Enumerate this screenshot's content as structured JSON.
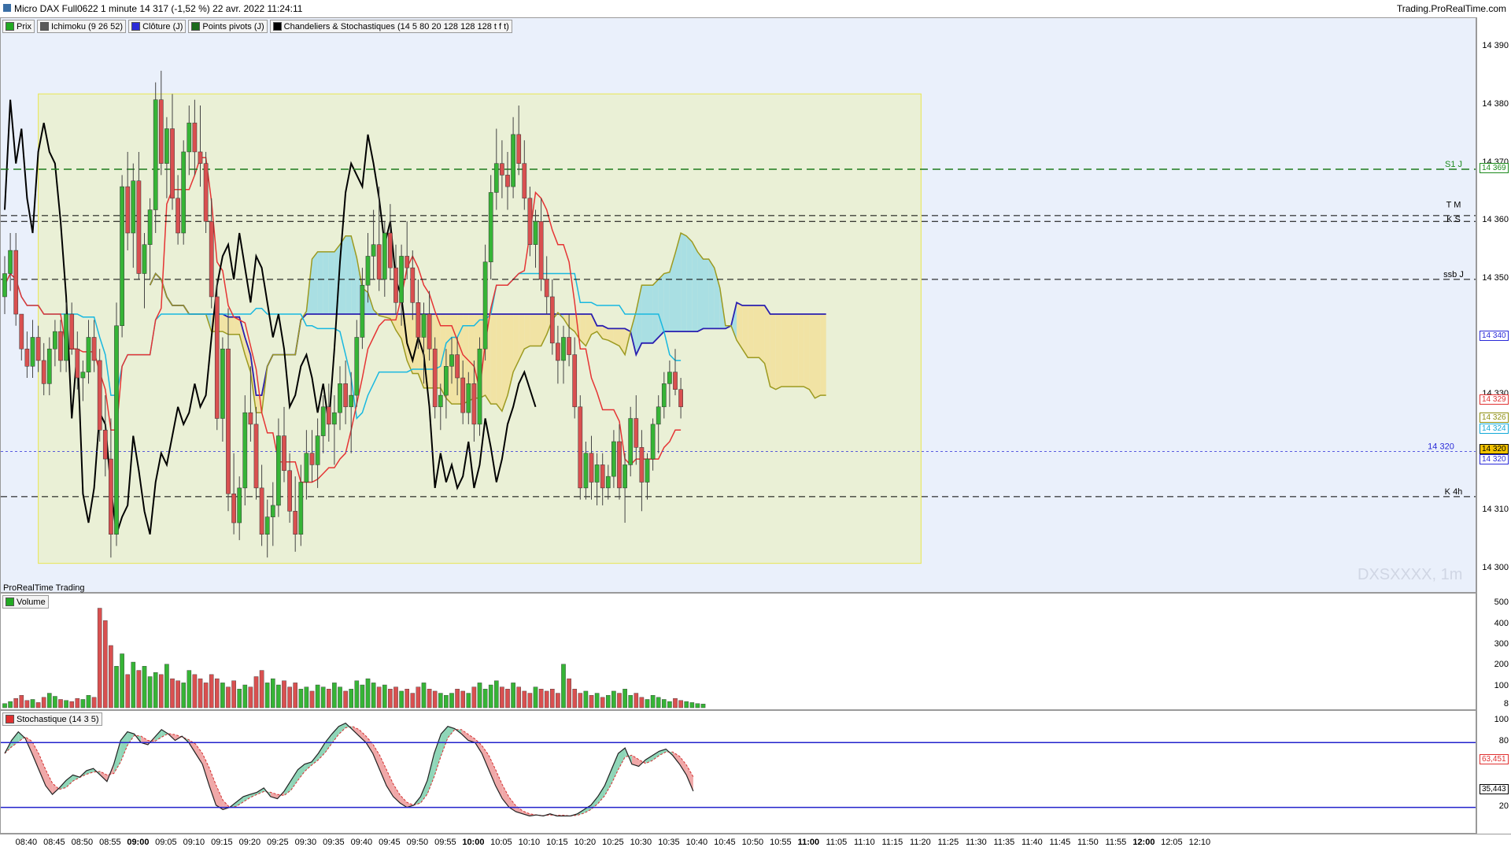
{
  "window": {
    "title": "Micro DAX Full0622 1 minute 14 317 (-1,52 %) 22 avr. 2022 11:24:11",
    "site": "Trading.ProRealTime.com"
  },
  "price_panel": {
    "legend": [
      {
        "label": "Prix",
        "color": "#22aa22"
      },
      {
        "label": "Ichimoku (9 26 52)",
        "color": "#5a5a5a"
      },
      {
        "label": "Clôture (J)",
        "color": "#2a2ad8"
      },
      {
        "label": "Points pivots (J)",
        "color": "#1c6b1c"
      },
      {
        "label": "Chandeliers & Stochastiques (14 5 80 20 128 128 128 t f t)",
        "color": "#000000"
      }
    ],
    "brand": "ProRealTime Trading",
    "watermark": "DXSXXXX, 1m",
    "y_ticks": [
      "14 390",
      "14 380",
      "14 370",
      "14 360",
      "14 350",
      "14 340",
      "14 330",
      "14 320",
      "14 310",
      "14 300"
    ],
    "tags": [
      {
        "text": "14 369",
        "color": "#1c8a1c"
      },
      {
        "text": "14 340",
        "color": "#2a2ad8"
      },
      {
        "text": "14 329",
        "color": "#e03030"
      },
      {
        "text": "14 326",
        "color": "#8f8f10"
      },
      {
        "text": "14 324",
        "color": "#12a8d8"
      },
      {
        "text": "14 320",
        "color": "#000000",
        "bg": "#f2c200"
      },
      {
        "text": "14 320",
        "color": "#2a2ad8"
      }
    ],
    "level_labels": [
      {
        "text": "S1 J",
        "color": "#1c8a1c"
      },
      {
        "text": "T M",
        "color": "#000000"
      },
      {
        "text": "K S",
        "color": "#000000"
      },
      {
        "text": "ssb J",
        "color": "#000000"
      },
      {
        "text": "14 320",
        "color": "#2a2ad8"
      },
      {
        "text": "K 4h",
        "color": "#000000"
      }
    ]
  },
  "volume_panel": {
    "legend": [
      {
        "label": "Volume",
        "color": "#22aa22"
      }
    ],
    "y_ticks": [
      "500",
      "400",
      "300",
      "200",
      "100",
      "8"
    ]
  },
  "stoch_panel": {
    "legend": [
      {
        "label": "Stochastique (14 3 5)",
        "color": "#e03030"
      }
    ],
    "y_ticks": [
      "100",
      "80",
      "20"
    ],
    "tags": [
      {
        "text": "63,451",
        "color": "#e03030"
      },
      {
        "text": "35,443",
        "color": "#000000"
      }
    ]
  },
  "x_axis": {
    "labels": [
      "08:40",
      "08:45",
      "08:50",
      "08:55",
      "09:00",
      "09:05",
      "09:10",
      "09:15",
      "09:20",
      "09:25",
      "09:30",
      "09:35",
      "09:40",
      "09:45",
      "09:50",
      "09:55",
      "10:00",
      "10:05",
      "10:10",
      "10:15",
      "10:20",
      "10:25",
      "10:30",
      "10:35",
      "10:40",
      "10:45",
      "10:50",
      "10:55",
      "11:00",
      "11:05",
      "11:10",
      "11:15",
      "11:20",
      "11:25",
      "11:30",
      "11:35",
      "11:40",
      "11:45",
      "11:50",
      "11:55",
      "12:00",
      "12:05",
      "12:10"
    ],
    "bold": [
      "09:00",
      "10:00",
      "11:00",
      "12:00"
    ]
  },
  "chart_data": {
    "type": "candlestick",
    "symbol": "Micro DAX Full0622",
    "interval": "1 minute",
    "ylim": [
      14297,
      14394
    ],
    "levels": {
      "S1 J": 14369,
      "T M": 14361,
      "K S": 14360,
      "ssb J": 14350,
      "K 4h": 14312.5,
      "close_line": 14320.3
    },
    "range_box": {
      "t_start": 6,
      "t_end": 164,
      "high": 14382,
      "low": 14301
    },
    "candles_start": "08:36",
    "candles_ohlc": [
      [
        14347,
        14354,
        14344,
        14351
      ],
      [
        14351,
        14358,
        14348,
        14355
      ],
      [
        14355,
        14358,
        14342,
        14344
      ],
      [
        14344,
        14344,
        14336,
        14338
      ],
      [
        14338,
        14341,
        14333,
        14335
      ],
      [
        14335,
        14343,
        14333,
        14340
      ],
      [
        14340,
        14342,
        14334,
        14336
      ],
      [
        14336,
        14339,
        14330,
        14332
      ],
      [
        14332,
        14340,
        14330,
        14338
      ],
      [
        14338,
        14343,
        14335,
        14341
      ],
      [
        14341,
        14343,
        14334,
        14336
      ],
      [
        14336,
        14346,
        14334,
        14344
      ],
      [
        14344,
        14346,
        14337,
        14338
      ],
      [
        14338,
        14341,
        14331,
        14333
      ],
      [
        14333,
        14336,
        14329,
        14334
      ],
      [
        14334,
        14343,
        14332,
        14340
      ],
      [
        14340,
        14343,
        14334,
        14336
      ],
      [
        14336,
        14338,
        14322,
        14324
      ],
      [
        14324,
        14330,
        14316,
        14319
      ],
      [
        14319,
        14326,
        14302,
        14306
      ],
      [
        14306,
        14346,
        14304,
        14342
      ],
      [
        14342,
        14368,
        14340,
        14366
      ],
      [
        14366,
        14372,
        14355,
        14358
      ],
      [
        14358,
        14370,
        14352,
        14367
      ],
      [
        14367,
        14372,
        14350,
        14351
      ],
      [
        14351,
        14358,
        14345,
        14356
      ],
      [
        14356,
        14364,
        14350,
        14362
      ],
      [
        14362,
        14384,
        14358,
        14381
      ],
      [
        14381,
        14386,
        14368,
        14370
      ],
      [
        14370,
        14378,
        14364,
        14376
      ],
      [
        14376,
        14382,
        14362,
        14364
      ],
      [
        14364,
        14368,
        14356,
        14358
      ],
      [
        14358,
        14374,
        14356,
        14372
      ],
      [
        14372,
        14380,
        14368,
        14377
      ],
      [
        14377,
        14381,
        14368,
        14372
      ],
      [
        14372,
        14380,
        14366,
        14370
      ],
      [
        14370,
        14372,
        14358,
        14360
      ],
      [
        14360,
        14364,
        14345,
        14347
      ],
      [
        14347,
        14350,
        14324,
        14326
      ],
      [
        14326,
        14340,
        14322,
        14338
      ],
      [
        14338,
        14345,
        14310,
        14313
      ],
      [
        14313,
        14320,
        14306,
        14308
      ],
      [
        14308,
        14316,
        14305,
        14314
      ],
      [
        14314,
        14330,
        14311,
        14327
      ],
      [
        14327,
        14335,
        14322,
        14325
      ],
      [
        14325,
        14328,
        14312,
        14314
      ],
      [
        14314,
        14318,
        14304,
        14306
      ],
      [
        14306,
        14312,
        14302,
        14309
      ],
      [
        14309,
        14315,
        14304,
        14311
      ],
      [
        14311,
        14326,
        14309,
        14323
      ],
      [
        14323,
        14328,
        14315,
        14317
      ],
      [
        14317,
        14320,
        14308,
        14310
      ],
      [
        14310,
        14316,
        14303,
        14306
      ],
      [
        14306,
        14318,
        14304,
        14315
      ],
      [
        14315,
        14324,
        14312,
        14320
      ],
      [
        14320,
        14324,
        14315,
        14318
      ],
      [
        14318,
        14326,
        14314,
        14323
      ],
      [
        14323,
        14330,
        14320,
        14328
      ],
      [
        14328,
        14332,
        14322,
        14325
      ],
      [
        14325,
        14330,
        14318,
        14327
      ],
      [
        14327,
        14335,
        14324,
        14332
      ],
      [
        14332,
        14336,
        14325,
        14328
      ],
      [
        14328,
        14334,
        14320,
        14330
      ],
      [
        14330,
        14343,
        14328,
        14340
      ],
      [
        14340,
        14352,
        14338,
        14349
      ],
      [
        14349,
        14358,
        14346,
        14354
      ],
      [
        14354,
        14362,
        14350,
        14356
      ],
      [
        14356,
        14366,
        14348,
        14350
      ],
      [
        14350,
        14360,
        14347,
        14358
      ],
      [
        14358,
        14363,
        14350,
        14352
      ],
      [
        14352,
        14356,
        14344,
        14346
      ],
      [
        14346,
        14356,
        14342,
        14354
      ],
      [
        14354,
        14360,
        14350,
        14352
      ],
      [
        14352,
        14355,
        14343,
        14346
      ],
      [
        14346,
        14350,
        14338,
        14340
      ],
      [
        14340,
        14346,
        14332,
        14344
      ],
      [
        14344,
        14348,
        14336,
        14338
      ],
      [
        14338,
        14340,
        14326,
        14328
      ],
      [
        14328,
        14332,
        14324,
        14330
      ],
      [
        14330,
        14338,
        14326,
        14335
      ],
      [
        14335,
        14340,
        14332,
        14337
      ],
      [
        14337,
        14340,
        14330,
        14333
      ],
      [
        14333,
        14336,
        14325,
        14327
      ],
      [
        14327,
        14334,
        14325,
        14332
      ],
      [
        14332,
        14336,
        14322,
        14325
      ],
      [
        14325,
        14340,
        14323,
        14338
      ],
      [
        14338,
        14356,
        14336,
        14353
      ],
      [
        14353,
        14368,
        14350,
        14365
      ],
      [
        14365,
        14376,
        14362,
        14370
      ],
      [
        14370,
        14374,
        14364,
        14368
      ],
      [
        14368,
        14372,
        14362,
        14366
      ],
      [
        14366,
        14378,
        14364,
        14375
      ],
      [
        14375,
        14380,
        14368,
        14370
      ],
      [
        14370,
        14374,
        14362,
        14364
      ],
      [
        14364,
        14366,
        14354,
        14356
      ],
      [
        14356,
        14362,
        14352,
        14360
      ],
      [
        14360,
        14364,
        14348,
        14350
      ],
      [
        14350,
        14354,
        14344,
        14347
      ],
      [
        14347,
        14350,
        14337,
        14339
      ],
      [
        14339,
        14342,
        14332,
        14336
      ],
      [
        14336,
        14342,
        14332,
        14340
      ],
      [
        14340,
        14344,
        14335,
        14337
      ],
      [
        14337,
        14340,
        14326,
        14328
      ],
      [
        14328,
        14330,
        14312,
        14314
      ],
      [
        14314,
        14322,
        14312,
        14320
      ],
      [
        14320,
        14323,
        14312,
        14315
      ],
      [
        14315,
        14320,
        14311,
        14318
      ],
      [
        14318,
        14320,
        14311,
        14314
      ],
      [
        14314,
        14318,
        14312,
        14316
      ],
      [
        14316,
        14324,
        14314,
        14322
      ],
      [
        14322,
        14325,
        14312,
        14314
      ],
      [
        14314,
        14320,
        14308,
        14318
      ],
      [
        14318,
        14328,
        14316,
        14326
      ],
      [
        14326,
        14330,
        14318,
        14321
      ],
      [
        14321,
        14324,
        14310,
        14315
      ],
      [
        14315,
        14320,
        14312,
        14319
      ],
      [
        14319,
        14326,
        14317,
        14325
      ],
      [
        14325,
        14330,
        14320,
        14328
      ],
      [
        14328,
        14334,
        14326,
        14332
      ],
      [
        14332,
        14336,
        14328,
        14334
      ],
      [
        14334,
        14338,
        14330,
        14331
      ],
      [
        14331,
        14333,
        14326,
        14328
      ]
    ],
    "volume": [
      20,
      30,
      45,
      60,
      35,
      40,
      25,
      50,
      70,
      55,
      40,
      35,
      30,
      45,
      40,
      60,
      50,
      480,
      420,
      300,
      200,
      260,
      160,
      220,
      180,
      200,
      150,
      170,
      160,
      210,
      140,
      130,
      120,
      180,
      160,
      140,
      120,
      160,
      140,
      120,
      100,
      130,
      90,
      110,
      100,
      150,
      180,
      120,
      140,
      110,
      130,
      100,
      120,
      90,
      100,
      80,
      110,
      100,
      90,
      120,
      100,
      80,
      90,
      130,
      110,
      140,
      120,
      100,
      110,
      90,
      100,
      80,
      90,
      70,
      100,
      120,
      90,
      80,
      70,
      60,
      70,
      90,
      80,
      70,
      100,
      120,
      90,
      110,
      130,
      100,
      90,
      120,
      100,
      80,
      70,
      100,
      90,
      80,
      90,
      70,
      210,
      140,
      90,
      70,
      80,
      60,
      70,
      50,
      60,
      80,
      70,
      90,
      60,
      70,
      50,
      40,
      60,
      50,
      40,
      30,
      45,
      35,
      30,
      25,
      20,
      18
    ],
    "stochastic": {
      "k": [
        70,
        82,
        90,
        84,
        70,
        55,
        40,
        32,
        38,
        45,
        50,
        48,
        54,
        56,
        50,
        44,
        60,
        82,
        90,
        88,
        80,
        78,
        85,
        92,
        88,
        82,
        86,
        80,
        70,
        60,
        40,
        22,
        18,
        20,
        25,
        30,
        32,
        34,
        38,
        30,
        28,
        35,
        45,
        55,
        60,
        62,
        70,
        80,
        88,
        95,
        98,
        92,
        86,
        80,
        70,
        55,
        40,
        30,
        24,
        20,
        22,
        30,
        45,
        70,
        88,
        95,
        93,
        88,
        82,
        80,
        70,
        55,
        40,
        28,
        20,
        16,
        14,
        12,
        13,
        12,
        14,
        12,
        12,
        12,
        14,
        18,
        22,
        30,
        40,
        55,
        70,
        75,
        60,
        58,
        64,
        68,
        72,
        74,
        68,
        60,
        50,
        35
      ]
    }
  }
}
